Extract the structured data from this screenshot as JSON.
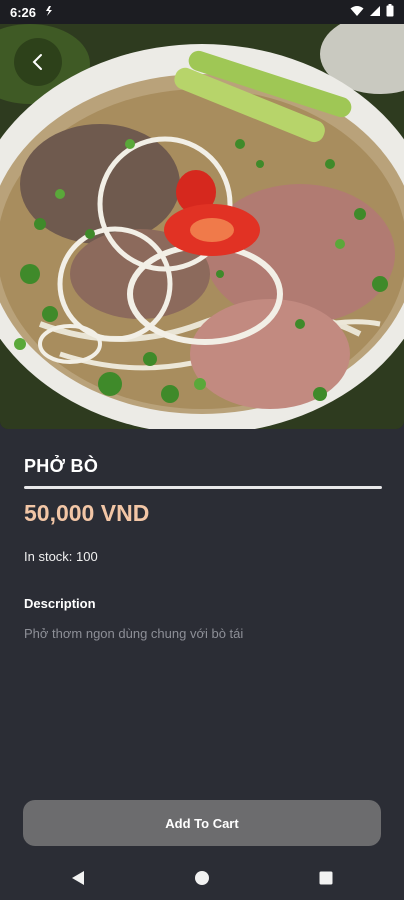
{
  "status_bar": {
    "time": "6:26",
    "icons": [
      "notification-icon",
      "wifi-icon",
      "signal-icon",
      "battery-icon"
    ]
  },
  "product": {
    "name": "PHỞ BÒ",
    "price": "50,000 VND",
    "stock": "In stock: 100",
    "description_heading": "Description",
    "description": "Phở thơm ngon dùng chung với bò tái"
  },
  "actions": {
    "add_to_cart": "Add To Cart"
  },
  "colors": {
    "background": "#2b2d35",
    "price": "#f2c6a6",
    "button": "#6c6c6e",
    "muted_text": "#8d8f97"
  },
  "icons": {
    "back": "back-arrow-icon",
    "nav": [
      "nav-back-icon",
      "nav-home-icon",
      "nav-recents-icon"
    ]
  }
}
